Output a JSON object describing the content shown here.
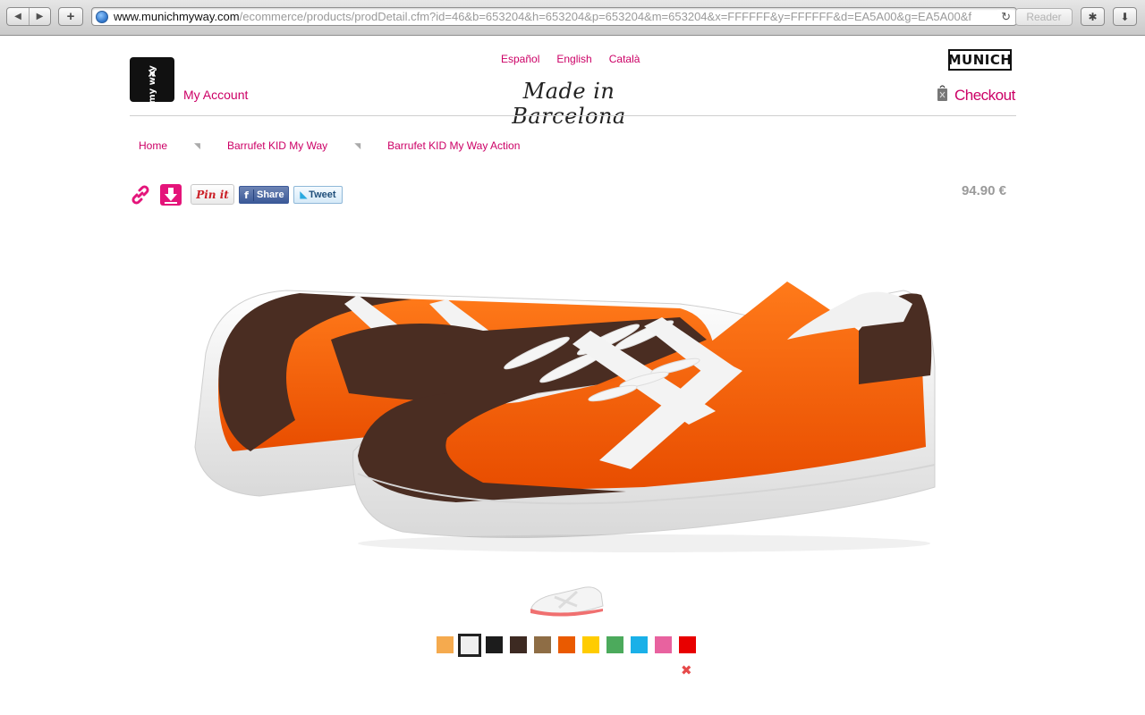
{
  "browser": {
    "url_host": "www.munichmyway.com",
    "url_path": "/ecommerce/products/prodDetail.cfm?id=46&b=653204&h=653204&p=653204&m=653204&x=FFFFFF&y=FFFFFF&d=EA5A00&g=EA5A00&f",
    "reader_label": "Reader"
  },
  "header": {
    "logo_text": "my way",
    "my_account": "My Account",
    "languages": [
      "Español",
      "English",
      "Català"
    ],
    "tagline": "Made in Barcelona",
    "brand": "MUNICH",
    "checkout": "Checkout"
  },
  "breadcrumb": [
    "Home",
    "Barrufet KID My Way",
    "Barrufet KID My Way Action"
  ],
  "share": {
    "pin_label": "Pin it",
    "facebook_label": "Share",
    "twitter_label": "Tweet"
  },
  "product": {
    "price": "94.90 €"
  },
  "colors": {
    "accent": "#cc0066",
    "swatches": [
      "#f5aa4e",
      "#efefef",
      "#1c1c1c",
      "#3d2a22",
      "#8e6d45",
      "#ea5a00",
      "#ffcc00",
      "#4caa5c",
      "#1ab0e8",
      "#e8629f",
      "#e80000"
    ],
    "selected_swatch_index": 1
  },
  "remove_icon": "close-icon"
}
